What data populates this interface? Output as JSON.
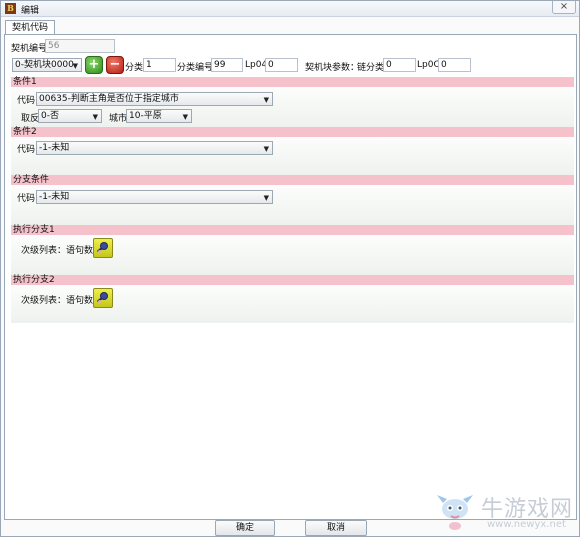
{
  "window": {
    "title": "编辑",
    "app_icon": "B",
    "close_symbol": "×"
  },
  "tab": {
    "label": "契机代码"
  },
  "top": {
    "contract_id_label": "契机编号",
    "contract_id_value": "56",
    "block_select": "0-契机块0000",
    "add_symbol": "+",
    "remove_symbol": "−",
    "category_label": "分类",
    "category_value": "1",
    "category_no_label": "分类编号",
    "category_no_value": "99",
    "lp04_label": "Lp04",
    "lp04_value": "0",
    "block_params_label": "契机块参数：",
    "chain_category_label": "链分类",
    "chain_category_value": "0",
    "lp0c_label": "Lp0C",
    "lp0c_value": "0"
  },
  "condition1": {
    "header": "条件1",
    "code_label": "代码",
    "code_value": "00635-判断主角是否位于指定城市",
    "negate_label": "取反",
    "negate_value": "0-否",
    "city_label": "城市",
    "city_value": "10-平原"
  },
  "condition2": {
    "header": "条件2",
    "code_label": "代码",
    "code_value": "-1-未知"
  },
  "branch_condition": {
    "header": "分支条件",
    "code_label": "代码",
    "code_value": "-1-未知"
  },
  "branch1": {
    "header": "执行分支1",
    "list_label": "次级列表：语句数1"
  },
  "branch2": {
    "header": "执行分支2",
    "list_label": "次级列表：语句数0"
  },
  "footer": {
    "ok_label": "确定",
    "cancel_label": "取消"
  },
  "watermark": {
    "text": "牛游戏网",
    "url": "www.newyx.net"
  },
  "colors": {
    "section_header": "#f5c2cb",
    "add_button": "#2f8b1d",
    "remove_button": "#b81d12",
    "search_button": "#c2c71a"
  },
  "icons": {
    "add": "plus-icon",
    "remove": "minus-icon",
    "search": "search-icon",
    "dropdown": "chevron-down-icon"
  }
}
